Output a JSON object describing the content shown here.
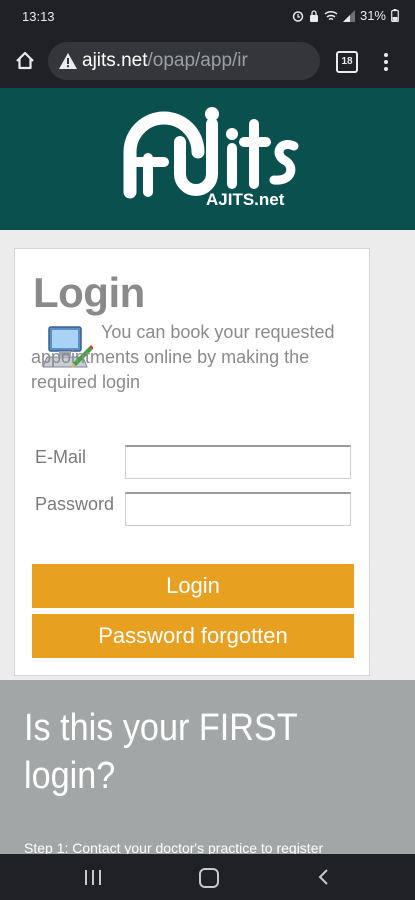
{
  "status_bar": {
    "time": "13:13",
    "battery": "31%"
  },
  "browser": {
    "url_host": "ajits.net",
    "url_path": "/opap/app/ir",
    "tab_count": "18"
  },
  "header": {
    "logo_sub": "AJITS.net"
  },
  "login_card": {
    "title": "Login",
    "intro": "You can book your requested appointments online by making the required login",
    "email_label": "E-Mail",
    "email_value": "",
    "password_label": "Password",
    "password_value": "",
    "login_button": "Login",
    "forgot_button": "Password forgotten"
  },
  "first_login": {
    "title": "Is this your FIRST login?",
    "step1": "Step 1:   Contact your doctor's practice to register"
  },
  "colors": {
    "banner": "#09504e",
    "button": "#e8a020",
    "gray_section": "#a3a6a6"
  }
}
